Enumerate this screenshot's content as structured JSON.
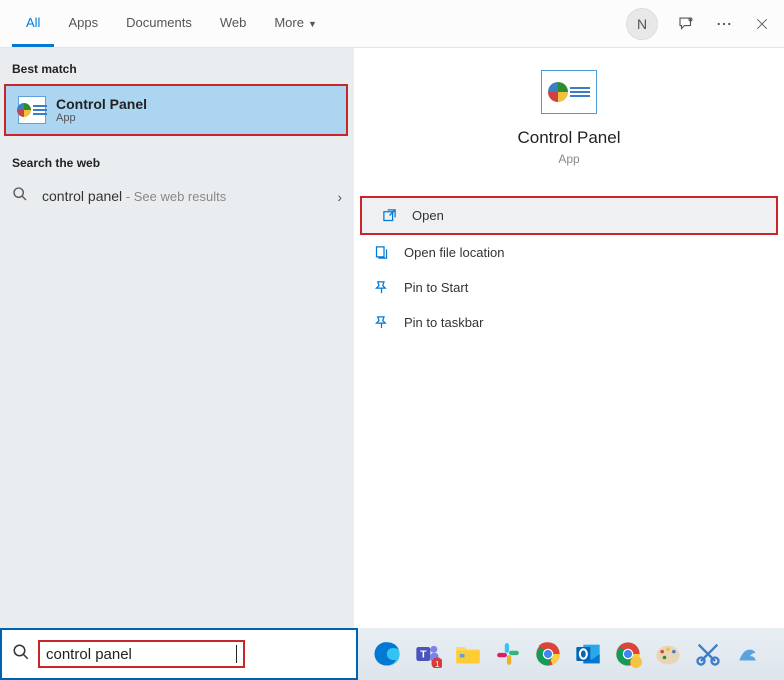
{
  "header": {
    "tabs": [
      {
        "label": "All",
        "active": true
      },
      {
        "label": "Apps",
        "active": false
      },
      {
        "label": "Documents",
        "active": false
      },
      {
        "label": "Web",
        "active": false
      },
      {
        "label": "More",
        "active": false,
        "dropdown": true
      }
    ],
    "avatar_letter": "N"
  },
  "left": {
    "best_match_label": "Best match",
    "best_match": {
      "title": "Control Panel",
      "subtitle": "App"
    },
    "web_label": "Search the web",
    "web_item": {
      "text": "control panel",
      "suffix": " - See web results"
    }
  },
  "right": {
    "title": "Control Panel",
    "subtitle": "App",
    "actions": [
      {
        "label": "Open",
        "icon": "open",
        "highlight": true
      },
      {
        "label": "Open file location",
        "icon": "location",
        "highlight": false
      },
      {
        "label": "Pin to Start",
        "icon": "pin",
        "highlight": false
      },
      {
        "label": "Pin to taskbar",
        "icon": "pin",
        "highlight": false
      }
    ]
  },
  "search": {
    "value": "control panel"
  },
  "tray_icons": [
    "edge",
    "teams",
    "explorer",
    "slack",
    "chrome",
    "outlook",
    "chrome2",
    "paint",
    "snip",
    "misc"
  ]
}
